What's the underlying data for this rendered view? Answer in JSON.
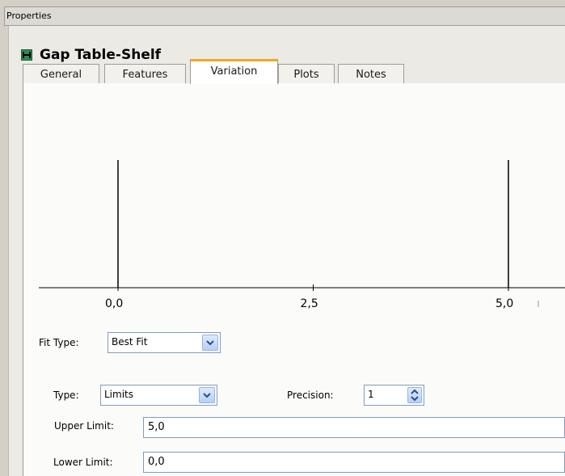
{
  "panel": {
    "title": "Properties"
  },
  "header": {
    "icon": "dimension-gap-icon",
    "title": "Gap Table-Shelf"
  },
  "tabs": [
    {
      "label": "General",
      "active": false
    },
    {
      "label": "Features",
      "active": false
    },
    {
      "label": "Variation",
      "active": true
    },
    {
      "label": "Plots",
      "active": false
    },
    {
      "label": "Notes",
      "active": false
    }
  ],
  "chart_data": {
    "type": "line",
    "x_ticks": [
      "0,0",
      "2,5",
      "5,0"
    ],
    "xlim": [
      -1.0,
      5.6
    ],
    "vertical_lines": [
      {
        "name": "Lower Limit",
        "x": 0.0
      },
      {
        "name": "Upper Limit",
        "x": 5.0
      }
    ],
    "title": "",
    "xlabel": "",
    "ylabel": "",
    "grid": false
  },
  "fit_type": {
    "label": "Fit Type:",
    "value": "Best Fit"
  },
  "type": {
    "label": "Type:",
    "value": "Limits"
  },
  "precision": {
    "label": "Precision:",
    "value": "1"
  },
  "upper_limit": {
    "label": "Upper Limit:",
    "value": "5,0"
  },
  "lower_limit": {
    "label": "Lower Limit:",
    "value": "0,0"
  }
}
